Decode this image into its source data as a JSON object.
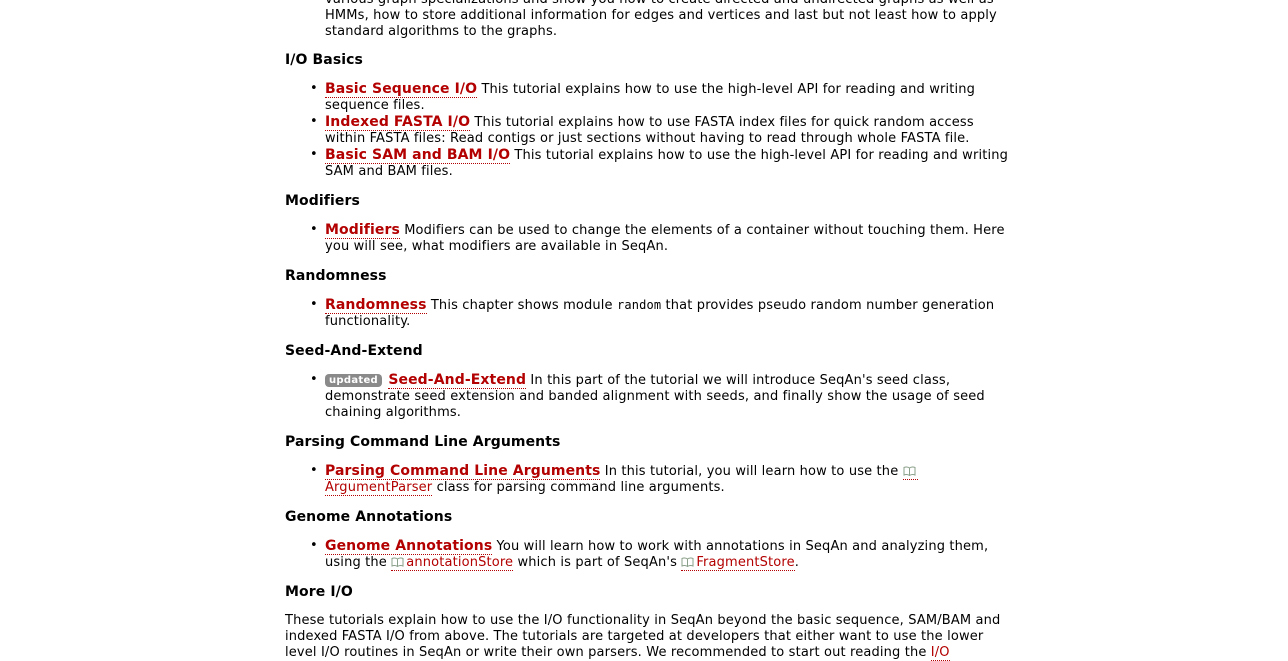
{
  "intro": {
    "line1": "various graph specializations and show you how to create directed and undirected graphs as well as",
    "line2": "HMMs, how to store additional information for edges and vertices and last but not least how to apply",
    "line3": "standard algorithms to the graphs."
  },
  "sections": {
    "io_basics": {
      "heading": "I/O Basics",
      "items": [
        {
          "title": "Basic Sequence I/O",
          "desc": " This tutorial explains how to use the high-level API for reading and writing sequence files."
        },
        {
          "title": "Indexed FASTA I/O",
          "desc": " This tutorial explains how to use FASTA index files for quick random access within FASTA files: Read contigs or just sections without having to read through whole FASTA file."
        },
        {
          "title": "Basic SAM and BAM I/O",
          "desc": " This tutorial explains how to use the high-level API for reading and writing SAM and BAM files."
        }
      ]
    },
    "modifiers": {
      "heading": "Modifiers",
      "items": [
        {
          "title": "Modifiers",
          "desc": " Modifiers can be used to change the elements of a container without touching them. Here you will see, what modifiers are available in SeqAn."
        }
      ]
    },
    "randomness": {
      "heading": "Randomness",
      "item": {
        "title": "Randomness",
        "desc_a": " This chapter shows module ",
        "code": "random",
        "desc_b": " that provides pseudo random number generation functionality."
      }
    },
    "seed": {
      "heading": "Seed-And-Extend",
      "item": {
        "badge": "updated",
        "title": "Seed-And-Extend",
        "desc": " In this part of the tutorial we will introduce SeqAn's seed class, demonstrate seed extension and banded alignment with seeds, and finally show the usage of seed chaining algorithms."
      }
    },
    "parsing": {
      "heading": "Parsing Command Line Arguments",
      "item": {
        "title": "Parsing Command Line Arguments",
        "desc_a": " In this tutorial, you will learn how to use the ",
        "ref": "ArgumentParser",
        "desc_b": " class for parsing command line arguments."
      }
    },
    "genome": {
      "heading": "Genome Annotations",
      "item": {
        "title": "Genome Annotations",
        "desc_a": " You will learn how to work with annotations in SeqAn and analyzing them, using the ",
        "ref1": "annotationStore",
        "desc_b": " which is part of SeqAn's ",
        "ref2": "FragmentStore",
        "desc_c": "."
      }
    },
    "more_io": {
      "heading": "More I/O",
      "text": "These tutorials explain how to use the I/O functionality in SeqAn beyond the basic sequence, SAM/BAM and indexed FASTA I/O from above. The tutorials are targeted at developers that either want to use the lower level I/O routines in SeqAn or write their own parsers. We recommended to start out reading the ",
      "link": "I/O"
    }
  },
  "colors": {
    "link": "#b30000",
    "badge": "#8a8a8a"
  },
  "icons": {
    "ref": "book-icon",
    "bullet": "bullet"
  }
}
